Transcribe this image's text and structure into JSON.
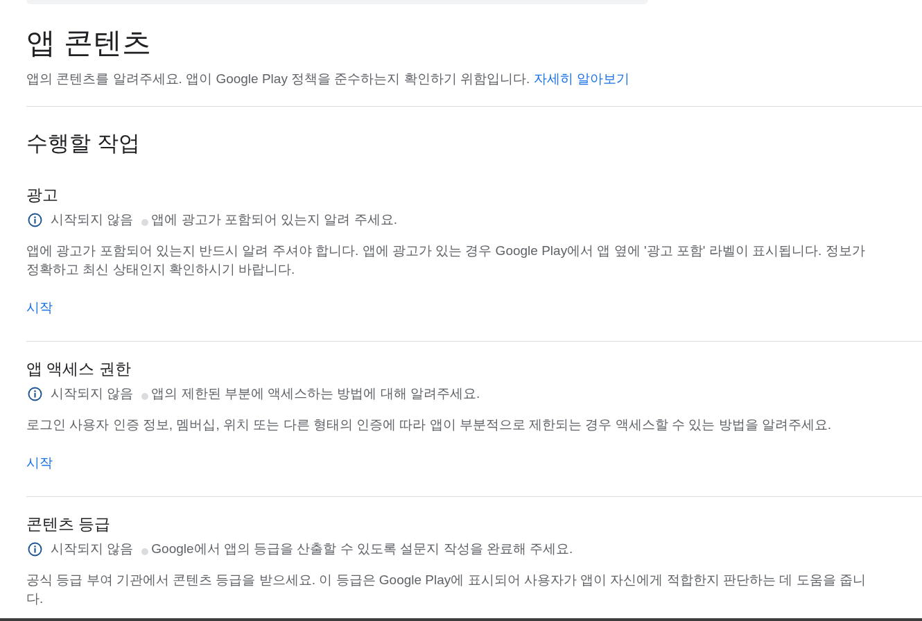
{
  "page": {
    "title": "앱 콘텐츠",
    "description": "앱의 콘텐츠를 알려주세요. 앱이 Google Play 정책을 준수하는지 확인하기 위함입니다.",
    "learn_more_link": "자세히 알아보기"
  },
  "tasks": {
    "heading": "수행할 작업",
    "items": [
      {
        "title": "광고",
        "status": "시작되지 않음",
        "summary": "앱에 광고가 포함되어 있는지 알려 주세요.",
        "details": "앱에 광고가 포함되어 있는지 반드시 알려 주셔야 합니다. 앱에 광고가 있는 경우 Google Play에서 앱 옆에 '광고 포함' 라벨이 표시됩니다. 정보가 정확하고 최신 상태인지 확인하시기 바랍니다.",
        "action": "시작"
      },
      {
        "title": "앱 액세스 권한",
        "status": "시작되지 않음",
        "summary": "앱의 제한된 부분에 액세스하는 방법에 대해 알려주세요.",
        "details": "로그인 사용자 인증 정보, 멤버십, 위치 또는 다른 형태의 인증에 따라 앱이 부분적으로 제한되는 경우 액세스할 수 있는 방법을 알려주세요.",
        "action": "시작"
      },
      {
        "title": "콘텐츠 등급",
        "status": "시작되지 않음",
        "summary": "Google에서 앱의 등급을 산출할 수 있도록 설문지 작성을 완료해 주세요.",
        "details": "공식 등급 부여 기관에서 콘텐츠 등급을 받으세요. 이 등급은 Google Play에 표시되어 사용자가 앱이 자신에게 적합한지 판단하는 데 도움을 줍니다."
      }
    ]
  }
}
